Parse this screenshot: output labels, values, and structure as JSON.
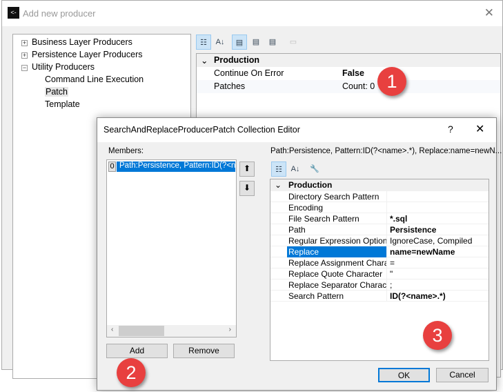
{
  "outer": {
    "title": "Add new producer",
    "close": "✕",
    "tree": [
      {
        "label": "Business Layer Producers",
        "exp": "+"
      },
      {
        "label": "Persistence Layer Producers",
        "exp": "+"
      },
      {
        "label": "Utility Producers",
        "exp": "−"
      },
      {
        "label": "Command Line Execution"
      },
      {
        "label": "Patch"
      },
      {
        "label": "Template"
      }
    ],
    "grid": {
      "category": "Production",
      "rows": [
        {
          "name": "Continue On Error",
          "value": "False"
        },
        {
          "name": "Patches",
          "value": "Count: 0"
        }
      ]
    }
  },
  "dialog": {
    "title": "SearchAndReplaceProducerPatch Collection Editor",
    "help": "?",
    "close": "✕",
    "members_label": "Members:",
    "member_index": "0",
    "member_text": "Path:Persistence, Pattern:ID(?<name>.*), Replace:name=newName",
    "desc": "Path:Persistence, Pattern:ID(?<name>.*), Replace:name=newN...",
    "category": "Production",
    "props": [
      {
        "name": "Directory Search Pattern",
        "value": ""
      },
      {
        "name": "Encoding",
        "value": ""
      },
      {
        "name": "File Search Pattern",
        "value": "*.sql",
        "bold": true
      },
      {
        "name": "Path",
        "value": "Persistence",
        "bold": true
      },
      {
        "name": "Regular Expression Options",
        "value": "IgnoreCase, Compiled"
      },
      {
        "name": "Replace",
        "value": "name=newName",
        "bold": true,
        "selected": true
      },
      {
        "name": "Replace Assignment Characte",
        "value": "="
      },
      {
        "name": "Replace Quote Character",
        "value": "\""
      },
      {
        "name": "Replace Separator Character",
        "value": ";"
      },
      {
        "name": "Search Pattern",
        "value": "ID(?<name>.*)",
        "bold": true
      }
    ],
    "add": "Add",
    "remove": "Remove",
    "ok": "OK",
    "cancel": "Cancel"
  },
  "badges": [
    "1",
    "2",
    "3"
  ],
  "colors": {
    "selection": "#0078d7",
    "badge": "#e8403f"
  }
}
